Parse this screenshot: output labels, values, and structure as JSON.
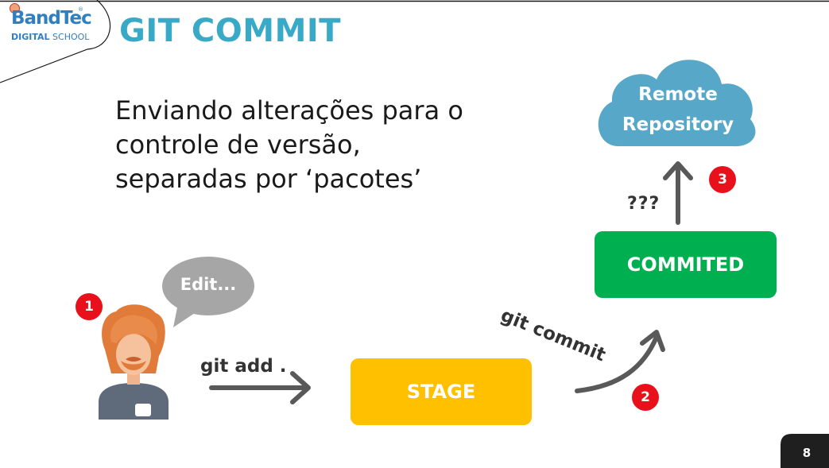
{
  "header": {
    "logo_main": "BandTec",
    "logo_trademark": "®",
    "logo_sub_bold": "DIGITAL",
    "logo_sub_rest": " SCHOOL",
    "title": "GIT COMMIT"
  },
  "body": {
    "lines": [
      "Enviando alterações para o",
      "controle de versão,",
      "separadas por ‘pacotes’"
    ]
  },
  "diagram": {
    "cloud_lines": [
      "Remote",
      "Repository"
    ],
    "commited_label": "COMMITED",
    "stage_label": "STAGE",
    "speech_bubble": "Edit...",
    "git_add_label": "git add .",
    "git_commit_label": "git commit",
    "unknown_step_label": "???",
    "badges": [
      "1",
      "2",
      "3"
    ]
  },
  "footer": {
    "page_number": "8"
  },
  "colors": {
    "title": "#38a9c7",
    "logo": "#2f7fc1",
    "cloud": "#56a7c8",
    "commited": "#00b050",
    "stage": "#ffc000",
    "badge": "#e8101b",
    "bubble": "#a6a6a6",
    "arrow": "#595959"
  }
}
